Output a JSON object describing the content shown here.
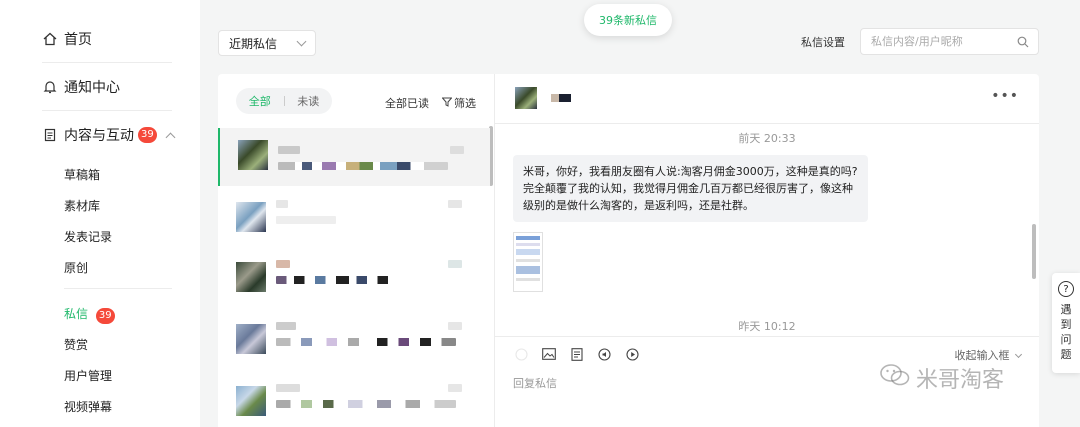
{
  "sidebar": {
    "home": "首页",
    "notifications": "通知中心",
    "content": "内容与互动",
    "content_badge": "39",
    "sub": [
      "草稿箱",
      "素材库",
      "发表记录",
      "原创"
    ],
    "messages": "私信",
    "messages_badge": "39",
    "sub2": [
      "赞赏",
      "用户管理",
      "视频弹幕"
    ]
  },
  "toolbar": {
    "recent": "近期私信",
    "new_messages": "39条新私信",
    "settings": "私信设置",
    "search_placeholder": "私信内容/用户昵称"
  },
  "list": {
    "tab_all": "全部",
    "tab_unread": "未读",
    "mark_all_read": "全部已读",
    "filter": "筛选"
  },
  "chat": {
    "time1": "前天 20:33",
    "message": "米哥，你好，我看朋友圈有人说:淘客月佣金3000万，这种是真的吗?完全颠覆了我的认知，我觉得月佣金几百万都已经很厉害了，像这种级别的是做什么淘客的，是返利吗，还是社群。",
    "time2": "昨天 10:12",
    "collapse": "收起输入框",
    "reply_placeholder": "回复私信"
  },
  "help": {
    "label": "遇到问题"
  },
  "watermark": "米哥淘客",
  "colors": {
    "accent": "#1fb86a",
    "badge": "#f5493a"
  }
}
